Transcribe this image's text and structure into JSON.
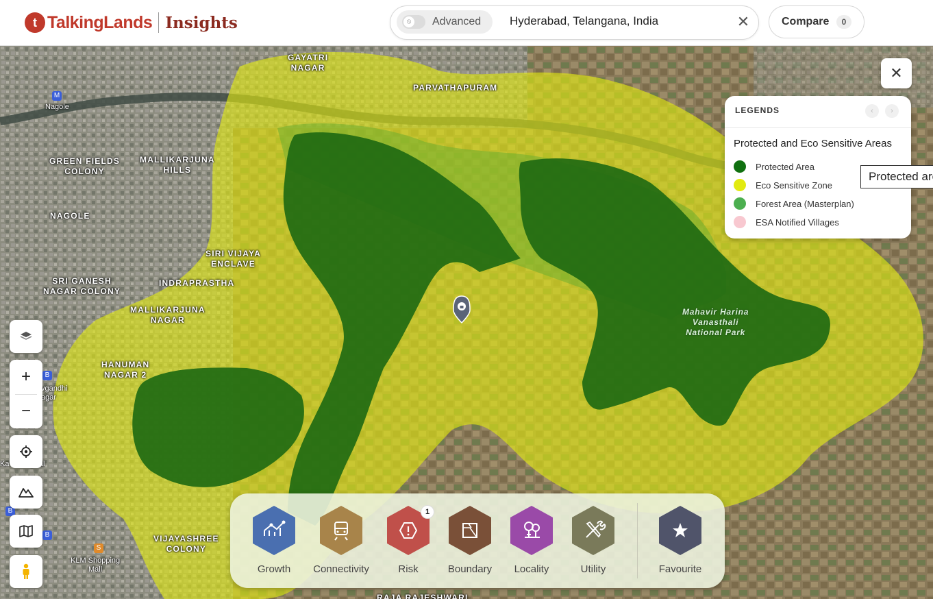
{
  "header": {
    "brand": "TalkingLands",
    "product": "Insights",
    "advanced_label": "Advanced",
    "search_value": "Hyderabad, Telangana, India",
    "compare_label": "Compare",
    "compare_count": "0"
  },
  "map": {
    "places": [
      {
        "id": "gayatri",
        "text": "GAYATRI\nNAGAR"
      },
      {
        "id": "parvathapuram",
        "text": "PARVATHAPURAM"
      },
      {
        "id": "greenfields",
        "text": "GREEN FIELDS\nCOLONY"
      },
      {
        "id": "mallikarjuna-hills",
        "text": "MALLIKARJUNA\nHILLS"
      },
      {
        "id": "nagole",
        "text": "NAGOLE"
      },
      {
        "id": "sirivijaya",
        "text": "SIRI VIJAYA\nENCLAVE"
      },
      {
        "id": "sriganesh",
        "text": "SRI GANESH\nNAGAR COLONY"
      },
      {
        "id": "indraprastha",
        "text": "INDRAPRASTHA"
      },
      {
        "id": "mallikarjuna-nagar",
        "text": "MALLIKARJUNA\nNAGAR"
      },
      {
        "id": "hanuman",
        "text": "HANUMAN\nNAGAR 2"
      },
      {
        "id": "vijayashree",
        "text": "VIJAYASHREE\nCOLONY"
      },
      {
        "id": "raja",
        "text": "RAJA RAJESHWARI"
      }
    ],
    "park_label": "Mahavir Harina\nVanasthali\nNational Park",
    "pois": [
      {
        "id": "nagole-station",
        "text": "Nagole"
      },
      {
        "id": "klm",
        "text": "KLM Shopping\nMall"
      },
      {
        "id": "hospital",
        "text": "Ka    Hospital"
      },
      {
        "id": "vgandhi",
        "text": "vgandhi\nagar"
      }
    ]
  },
  "legend": {
    "title": "LEGENDS",
    "subtitle": "Protected and Eco Sensitive Areas",
    "items": [
      {
        "label": "Protected Area",
        "color": "#107010"
      },
      {
        "label": "Eco Sensitive Zone",
        "color": "#e2ea10"
      },
      {
        "label": "Forest Area (Masterplan)",
        "color": "#4caf50"
      },
      {
        "label": "ESA Notified Villages",
        "color": "#f8c8d0"
      }
    ],
    "tooltip": "Protected area"
  },
  "categories": [
    {
      "label": "Growth",
      "color": "#4a6fb0"
    },
    {
      "label": "Connectivity",
      "color": "#a8844a"
    },
    {
      "label": "Risk",
      "color": "#c0504a",
      "badge": "1"
    },
    {
      "label": "Boundary",
      "color": "#7a5038"
    },
    {
      "label": "Locality",
      "color": "#9a4aa8"
    },
    {
      "label": "Utility",
      "color": "#7a7a5a"
    },
    {
      "label": "Favourite",
      "color": "#50546a"
    }
  ]
}
